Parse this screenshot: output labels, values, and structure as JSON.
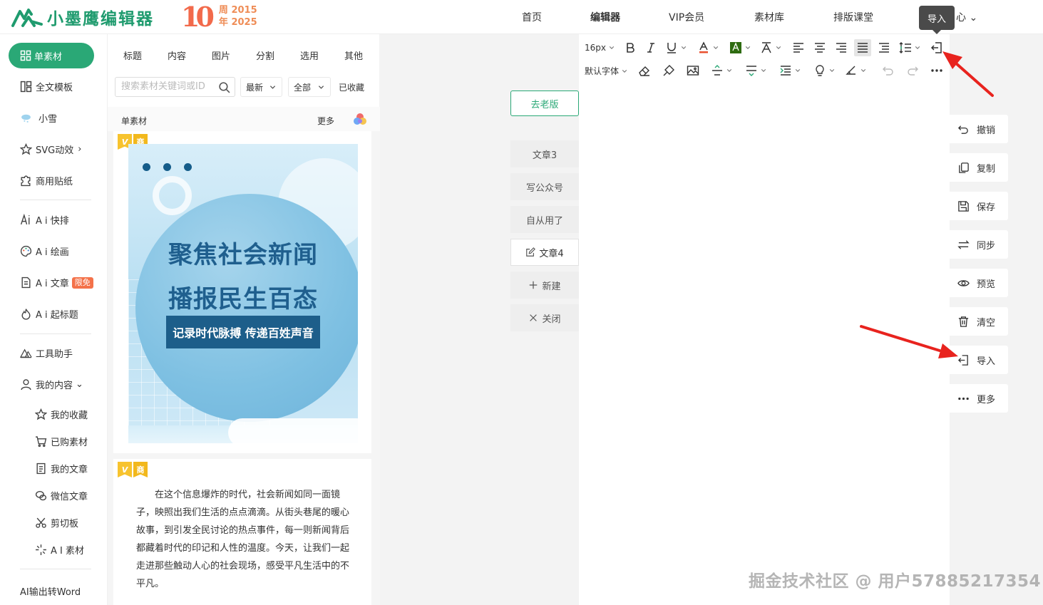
{
  "brand": {
    "name": "小墨鹰编辑器",
    "anniversary_number": "10",
    "anniversary_prefix1": "周",
    "anniversary_year1": "2015",
    "anniversary_prefix2": "年",
    "anniversary_year2": "2025",
    "brand_color": "#2aa876"
  },
  "nav": {
    "items": [
      "首页",
      "编辑器",
      "VIP会员",
      "素材库",
      "排版课堂"
    ],
    "active": "编辑器",
    "partial_item": "心",
    "tooltip": "导入"
  },
  "sidebar": {
    "primary": "单素材",
    "items": [
      {
        "label": "全文模板",
        "icon": "layout-icon"
      },
      {
        "label": "小雪",
        "icon": "snow-cloud-icon"
      },
      {
        "label": "SVG动效",
        "icon": "star-icon",
        "suffix": "›"
      },
      {
        "label": "商用贴纸",
        "icon": "puzzle-icon"
      },
      {
        "label": "A i 快排",
        "icon": "ai-icon"
      },
      {
        "label": "A i 绘画",
        "icon": "palette-icon"
      },
      {
        "label": "A i 文章",
        "icon": "document-icon",
        "badge": "限免"
      },
      {
        "label": "A i 起标题",
        "icon": "fire-icon"
      },
      {
        "label": "工具助手",
        "icon": "tools-icon"
      },
      {
        "label": "我的内容",
        "icon": "user-icon",
        "suffix": "⌄"
      }
    ],
    "sub_items": [
      {
        "label": "我的收藏",
        "icon": "star-icon"
      },
      {
        "label": "已购素材",
        "icon": "cart-icon"
      },
      {
        "label": "我的文章",
        "icon": "article-icon"
      },
      {
        "label": "微信文章",
        "icon": "wechat-icon"
      },
      {
        "label": "剪切板",
        "icon": "scissors-icon"
      },
      {
        "label": "A I 素材",
        "icon": "sparkle-icon"
      }
    ],
    "bottom": "AI输出转Word"
  },
  "material": {
    "tabs": [
      "标题",
      "内容",
      "图片",
      "分割",
      "选用",
      "其他"
    ],
    "search_placeholder": "搜索素材关键词或ID",
    "sort": "最新",
    "filter": "全部",
    "favorites": "已收藏",
    "section": "单素材",
    "more": "更多",
    "tag_v": "V",
    "tag_shang": "商",
    "poster": {
      "line1": "聚焦社会新闻",
      "line2": "播报民生百态",
      "band": "记录时代脉搏 传递百姓声音"
    },
    "article": "在这个信息爆炸的时代，社会新闻如同一面镜子，映照出我们生活的点点滴滴。从街头巷尾的暖心故事，到引发全民讨论的热点事件，每一则新闻背后都藏着时代的印记和人性的温度。今天，让我们一起走进那些触动人心的社会现场，感受平凡生活中的不平凡。"
  },
  "doc_panel": {
    "old_version": "去老版",
    "docs": [
      "文章3",
      "写公众号",
      "自从用了",
      "文章4"
    ],
    "active_doc": "文章4",
    "new": "新建",
    "close": "关闭"
  },
  "toolbar": {
    "font_size": "16px",
    "font_family": "默认字体",
    "highlight_color": "#2e6b10",
    "text_color": "#e8502f"
  },
  "actions": [
    "撤销",
    "复制",
    "保存",
    "同步",
    "预览",
    "清空",
    "导入",
    "更多"
  ],
  "watermark": "掘金技术社区 @ 用户57885217354"
}
